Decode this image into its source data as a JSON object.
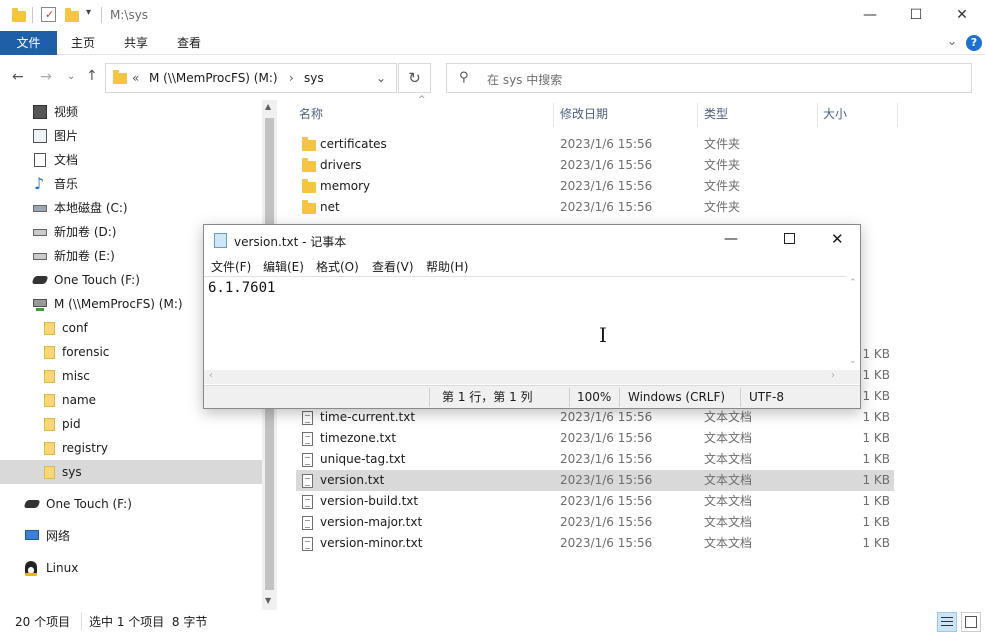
{
  "titlebar": {
    "path": "M:\\sys",
    "minimize": "—",
    "maximize": "☐",
    "close": "✕"
  },
  "ribbon": {
    "tabs": [
      "文件",
      "主页",
      "共享",
      "查看"
    ],
    "help": "?"
  },
  "nav": {
    "breadcrumb_root": "M (\\\\MemProcFS) (M:)",
    "breadcrumb_current": "sys",
    "search_placeholder": "在 sys 中搜索"
  },
  "sidebar": {
    "items": [
      {
        "label": "视频",
        "icon": "video-icon"
      },
      {
        "label": "图片",
        "icon": "picture-icon"
      },
      {
        "label": "文档",
        "icon": "document-icon"
      },
      {
        "label": "音乐",
        "icon": "music-icon"
      },
      {
        "label": "本地磁盘 (C:)",
        "icon": "system-drive-icon"
      },
      {
        "label": "新加卷 (D:)",
        "icon": "drive-icon"
      },
      {
        "label": "新加卷 (E:)",
        "icon": "drive-icon"
      },
      {
        "label": "One Touch (F:)",
        "icon": "usb-drive-icon"
      },
      {
        "label": "M (\\\\MemProcFS) (M:)",
        "icon": "network-drive-icon"
      },
      {
        "label": "conf",
        "icon": "folder-icon"
      },
      {
        "label": "forensic",
        "icon": "folder-icon"
      },
      {
        "label": "misc",
        "icon": "folder-icon"
      },
      {
        "label": "name",
        "icon": "folder-icon"
      },
      {
        "label": "pid",
        "icon": "folder-icon"
      },
      {
        "label": "registry",
        "icon": "folder-icon"
      },
      {
        "label": "sys",
        "icon": "folder-icon"
      },
      {
        "label": "One Touch (F:)",
        "icon": "usb-drive-icon"
      },
      {
        "label": "网络",
        "icon": "network-icon"
      },
      {
        "label": "Linux",
        "icon": "linux-icon"
      }
    ]
  },
  "columns": {
    "name": "名称",
    "date": "修改日期",
    "type": "类型",
    "size": "大小"
  },
  "files_top": [
    {
      "name": "certificates",
      "date": "2023/1/6 15:56",
      "type": "文件夹",
      "size": ""
    },
    {
      "name": "drivers",
      "date": "2023/1/6 15:56",
      "type": "文件夹",
      "size": ""
    },
    {
      "name": "memory",
      "date": "2023/1/6 15:56",
      "type": "文件夹",
      "size": ""
    },
    {
      "name": "net",
      "date": "2023/1/6 15:56",
      "type": "文件夹",
      "size": ""
    }
  ],
  "files_partial": [
    {
      "size": "1 KB"
    },
    {
      "size": "1 KB"
    },
    {
      "size": "1 KB"
    }
  ],
  "files_bottom": [
    {
      "name": "time-current.txt",
      "date": "2023/1/6 15:56",
      "type": "文本文档",
      "size": "1 KB"
    },
    {
      "name": "timezone.txt",
      "date": "2023/1/6 15:56",
      "type": "文本文档",
      "size": "1 KB"
    },
    {
      "name": "unique-tag.txt",
      "date": "2023/1/6 15:56",
      "type": "文本文档",
      "size": "1 KB"
    },
    {
      "name": "version.txt",
      "date": "2023/1/6 15:56",
      "type": "文本文档",
      "size": "1 KB"
    },
    {
      "name": "version-build.txt",
      "date": "2023/1/6 15:56",
      "type": "文本文档",
      "size": "1 KB"
    },
    {
      "name": "version-major.txt",
      "date": "2023/1/6 15:56",
      "type": "文本文档",
      "size": "1 KB"
    },
    {
      "name": "version-minor.txt",
      "date": "2023/1/6 15:56",
      "type": "文本文档",
      "size": "1 KB"
    }
  ],
  "status": {
    "count": "20 个项目",
    "selection": "选中 1 个项目  8 字节"
  },
  "notepad": {
    "title": "version.txt - 记事本",
    "menu": [
      "文件(F)",
      "编辑(E)",
      "格式(O)",
      "查看(V)",
      "帮助(H)"
    ],
    "content": "6.1.7601",
    "position": "第 1 行，第 1 列",
    "zoom": "100%",
    "line_ending": "Windows (CRLF)",
    "encoding": "UTF-8"
  }
}
